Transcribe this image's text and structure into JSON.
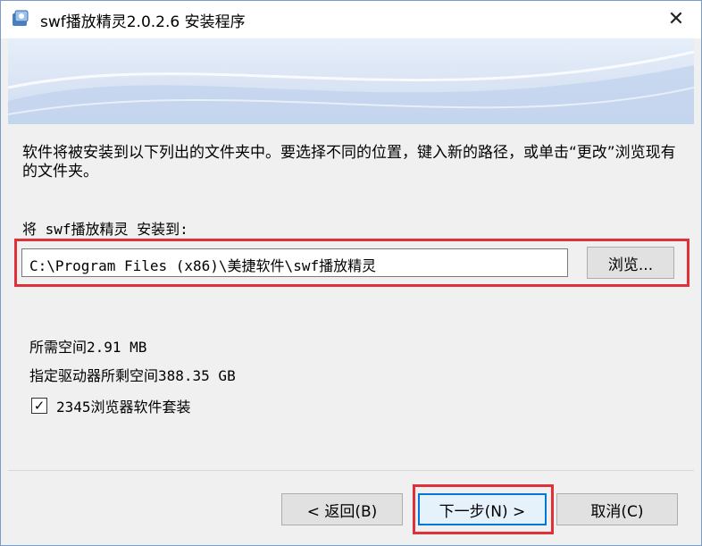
{
  "window": {
    "title": "swf播放精灵2.0.2.6 安装程序",
    "close_glyph": "✕",
    "accent": "#0078d7",
    "highlight": "#e0303a"
  },
  "content": {
    "intro": "软件将被安装到以下列出的文件夹中。要选择不同的位置，键入新的路径，或单击“更改”浏览现有的文件夹。",
    "install_label": "将 swf播放精灵 安装到:",
    "path_value": "C:\\Program Files (x86)\\美捷软件\\swf播放精灵",
    "browse_label": "浏览...",
    "space_required": "所需空间2.91 MB",
    "space_remaining": "指定驱动器所剩空间388.35 GB",
    "checkbox_checked": true,
    "checkbox_glyph": "✓",
    "checkbox_label": "2345浏览器软件套装"
  },
  "buttons": {
    "back": "< 返回(B)",
    "next": "下一步(N) >",
    "cancel": "取消(C)"
  }
}
